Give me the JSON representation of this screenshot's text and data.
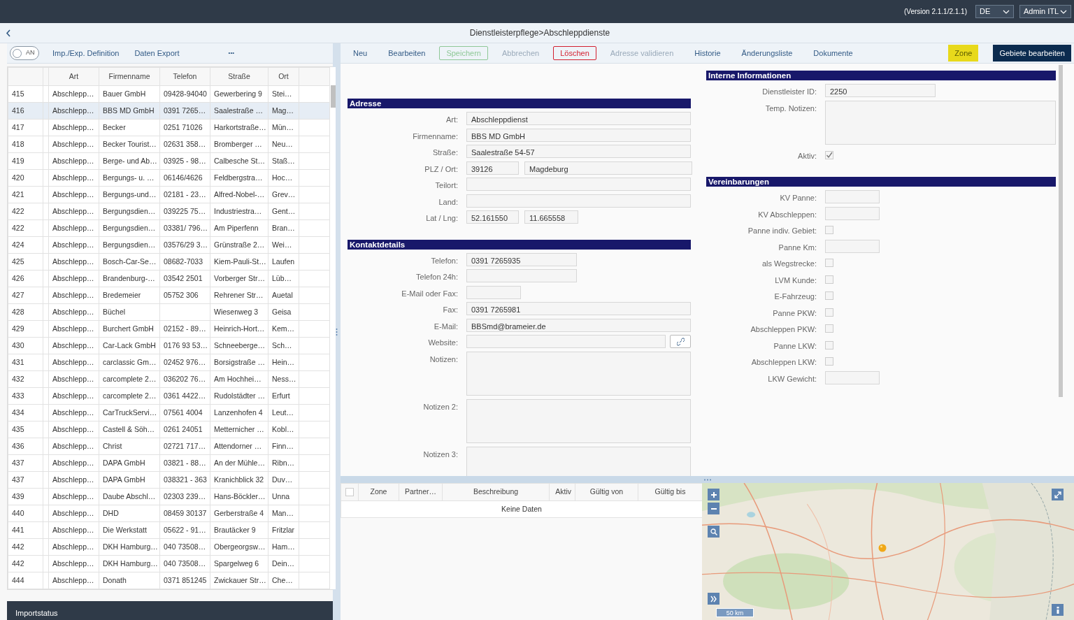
{
  "header": {
    "version": "(Version 2.1.1/2.1.1)",
    "language": "DE",
    "user": "Admin ITL"
  },
  "breadcrumb": "Dienstleisterpflege>Abschleppdienste",
  "left_toolbar": {
    "toggle": {
      "label": "AN",
      "on": false
    },
    "items": [
      "Imp./Exp. Definition",
      "Daten Export"
    ],
    "more": "•••"
  },
  "table": {
    "columns": [
      "Art",
      "Firmenname",
      "Telefon",
      "Straße",
      "Ort"
    ],
    "rows": [
      {
        "number": "415",
        "cells": [
          "Abschlepp…",
          "Bauer GmbH",
          "09428-94040",
          "Gewerbering 9",
          "Stei…"
        ],
        "selected": false
      },
      {
        "number": "416",
        "cells": [
          "Abschlepp…",
          "BBS MD GmbH",
          "0391 7265…",
          "Saalestraße …",
          "Mag…"
        ],
        "selected": true
      },
      {
        "number": "417",
        "cells": [
          "Abschlepp…",
          "Becker",
          "0251 71026",
          "Harkortstraße…",
          "Mün…"
        ],
        "selected": false
      },
      {
        "number": "418",
        "cells": [
          "Abschlepp…",
          "Becker Tourist…",
          "02631 358…",
          "Bromberger …",
          "Neu…"
        ],
        "selected": false
      },
      {
        "number": "419",
        "cells": [
          "Abschlepp…",
          "Berge- und Ab…",
          "03925 - 98…",
          "Calbesche St…",
          "Staß…"
        ],
        "selected": false
      },
      {
        "number": "420",
        "cells": [
          "Abschlepp…",
          "Bergungs- u. …",
          "06146/4626",
          "Feldbergstra…",
          "Hoc…"
        ],
        "selected": false
      },
      {
        "number": "421",
        "cells": [
          "Abschlepp…",
          "Bergungs-und…",
          "02181 - 23…",
          "Alfred-Nobel-…",
          "Grev…"
        ],
        "selected": false
      },
      {
        "number": "422",
        "cells": [
          "Abschlepp…",
          "Bergungsdien…",
          "039225 75…",
          "Industriestra…",
          "Gent…"
        ],
        "selected": false
      },
      {
        "number": "422",
        "cells": [
          "Abschlepp…",
          "Bergungsdien…",
          "03381/ 796…",
          "Am Piperfenn",
          "Bran…"
        ],
        "selected": false
      },
      {
        "number": "424",
        "cells": [
          "Abschlepp…",
          "Bergungsdien…",
          "03576/29 3…",
          "Grünstraße 2…",
          "Wei…"
        ],
        "selected": false
      },
      {
        "number": "425",
        "cells": [
          "Abschlepp…",
          "Bosch-Car-Se…",
          "08682-7033",
          "Kiem-Pauli-St…",
          "Laufen"
        ],
        "selected": false
      },
      {
        "number": "426",
        "cells": [
          "Abschlepp…",
          "Brandenburg-…",
          "03542 2501",
          "Vorberger Str…",
          "Lüb…"
        ],
        "selected": false
      },
      {
        "number": "427",
        "cells": [
          "Abschlepp…",
          "Bredemeier",
          "05752 306",
          "Rehrener Str…",
          "Auetal"
        ],
        "selected": false
      },
      {
        "number": "428",
        "cells": [
          "Abschlepp…",
          "Büchel",
          "",
          "Wiesenweg 3",
          "Geisa"
        ],
        "selected": false
      },
      {
        "number": "429",
        "cells": [
          "Abschlepp…",
          "Burchert GmbH",
          "02152 - 89…",
          "Heinrich-Hort…",
          "Kem…"
        ],
        "selected": false
      },
      {
        "number": "430",
        "cells": [
          "Abschlepp…",
          "Car-Lack GmbH",
          "0176 93 53…",
          "Schneeberge…",
          "Sch…"
        ],
        "selected": false
      },
      {
        "number": "431",
        "cells": [
          "Abschlepp…",
          "carclassic Gm…",
          "02452 976…",
          "Borsigstraße …",
          "Hein…"
        ],
        "selected": false
      },
      {
        "number": "432",
        "cells": [
          "Abschlepp…",
          "carcomplete 2…",
          "036202 76…",
          "Am Hochhei…",
          "Ness…"
        ],
        "selected": false
      },
      {
        "number": "433",
        "cells": [
          "Abschlepp…",
          "carcomplete 2…",
          "0361 4422…",
          "Rudolstädter …",
          "Erfurt"
        ],
        "selected": false
      },
      {
        "number": "434",
        "cells": [
          "Abschlepp…",
          "CarTruckServi…",
          "07561 4004",
          "Lanzenhofen 4",
          "Leut…"
        ],
        "selected": false
      },
      {
        "number": "435",
        "cells": [
          "Abschlepp…",
          "Castell & Söh…",
          "0261 24051",
          "Metternicher …",
          "Kobl…"
        ],
        "selected": false
      },
      {
        "number": "436",
        "cells": [
          "Abschlepp…",
          "Christ",
          "02721 717…",
          "Attendorner …",
          "Finn…"
        ],
        "selected": false
      },
      {
        "number": "437",
        "cells": [
          "Abschlepp…",
          "DAPA GmbH",
          "03821 - 88…",
          "An der Mühle…",
          "Ribn…"
        ],
        "selected": false
      },
      {
        "number": "437",
        "cells": [
          "Abschlepp…",
          "DAPA GmbH",
          "038321 - 363",
          "Kranichblick 32",
          "Duv…"
        ],
        "selected": false
      },
      {
        "number": "439",
        "cells": [
          "Abschlepp…",
          "Daube Abschl…",
          "02303 239…",
          "Hans-Böckler…",
          "Unna"
        ],
        "selected": false
      },
      {
        "number": "440",
        "cells": [
          "Abschlepp…",
          "DHD",
          "08459 30137",
          "Gerberstraße 4",
          "Man…"
        ],
        "selected": false
      },
      {
        "number": "441",
        "cells": [
          "Abschlepp…",
          "Die Werkstatt",
          "05622 - 91…",
          "Brautäcker 9",
          "Fritzlar"
        ],
        "selected": false
      },
      {
        "number": "442",
        "cells": [
          "Abschlepp…",
          "DKH Hamburg…",
          "040 73508…",
          "Obergeorgsw…",
          "Ham…"
        ],
        "selected": false
      },
      {
        "number": "442",
        "cells": [
          "Abschlepp…",
          "DKH Hamburg…",
          "040 73508…",
          "Spargelweg 6",
          "Dein…"
        ],
        "selected": false
      },
      {
        "number": "444",
        "cells": [
          "Abschlepp…",
          "Donath",
          "0371 851245",
          "Zwickauer Str…",
          "Che…"
        ],
        "selected": false
      }
    ]
  },
  "status_panel": {
    "title": "Importstatus"
  },
  "toolbar": {
    "buttons": [
      {
        "label": "Neu",
        "kind": "text",
        "disabled": false
      },
      {
        "label": "Bearbeiten",
        "kind": "text",
        "disabled": false
      },
      {
        "label": "Speichern",
        "kind": "success",
        "disabled": true
      },
      {
        "label": "Abbrechen",
        "kind": "text",
        "disabled": true
      },
      {
        "label": "Löschen",
        "kind": "danger",
        "disabled": false
      },
      {
        "label": "Adresse validieren",
        "kind": "text",
        "disabled": true
      },
      {
        "label": "Historie",
        "kind": "text",
        "disabled": false
      },
      {
        "label": "Änderungsliste",
        "kind": "text",
        "disabled": false
      },
      {
        "label": "Dokumente",
        "kind": "text",
        "disabled": false
      }
    ],
    "actions": [
      {
        "label": "Zone",
        "kind": "warning"
      },
      {
        "label": "Gebiete bearbeiten",
        "kind": "primary"
      }
    ]
  },
  "form": {
    "left": [
      {
        "title": "Adresse",
        "fields": [
          {
            "label": "Art:",
            "kind": "long",
            "value": "Abschleppdienst"
          },
          {
            "label": "Firmenname:",
            "kind": "long",
            "value": "BBS MD GmbH"
          },
          {
            "label": "Straße:",
            "kind": "long",
            "value": "Saalestraße 54-57"
          },
          {
            "label": "PLZ / Ort:",
            "kind": "pair",
            "values": [
              "39126",
              "Magdeburg"
            ]
          },
          {
            "label": "Teilort:",
            "kind": "long"
          },
          {
            "label": "Land:",
            "kind": "long"
          },
          {
            "label": "Lat / Lng:",
            "kind": "coords",
            "values": [
              "52.161550",
              "11.665558"
            ]
          }
        ]
      },
      {
        "title": "Kontaktdetails",
        "fields": [
          {
            "label": "Telefon:",
            "kind": "medium",
            "value": "0391 7265935"
          },
          {
            "label": "Telefon 24h:",
            "kind": "medium"
          },
          {
            "label": "E-Mail oder Fax:",
            "kind": "short"
          },
          {
            "label": "Fax:",
            "kind": "long",
            "value": "0391 7265981"
          },
          {
            "label": "E-Mail:",
            "kind": "long",
            "value": "BBSmd@brameier.de"
          },
          {
            "label": "Website:",
            "kind": "link"
          },
          {
            "label": "Notizen:",
            "kind": "textarea"
          },
          {
            "label": "Notizen 2:",
            "kind": "textarea"
          },
          {
            "label": "Notizen 3:",
            "kind": "textarea"
          }
        ]
      }
    ],
    "right": [
      {
        "title": "Interne Informationen",
        "fields": [
          {
            "label": "Dienstleister ID:",
            "kind": "medium",
            "value": "2250"
          },
          {
            "label": "Temp. Notizen:",
            "kind": "textarea"
          },
          {
            "label": "Aktiv:",
            "kind": "checkbox",
            "checked": true
          }
        ]
      },
      {
        "title": "Vereinbarungen",
        "fields": [
          {
            "label": "KV Panne:",
            "kind": "short"
          },
          {
            "label": "KV Abschleppen:",
            "kind": "short"
          },
          {
            "label": "Panne indiv. Gebiet:",
            "kind": "checkbox",
            "checked": false
          },
          {
            "label": "Panne Km:",
            "kind": "short"
          },
          {
            "label": "als Wegstrecke:",
            "kind": "checkbox",
            "checked": false
          },
          {
            "label": "LVM Kunde:",
            "kind": "checkbox",
            "checked": false
          },
          {
            "label": "E-Fahrzeug:",
            "kind": "checkbox",
            "checked": false
          },
          {
            "label": "Panne PKW:",
            "kind": "checkbox",
            "checked": false
          },
          {
            "label": "Abschleppen PKW:",
            "kind": "checkbox",
            "checked": false
          },
          {
            "label": "Panne LKW:",
            "kind": "checkbox",
            "checked": false
          },
          {
            "label": "Abschleppen LKW:",
            "kind": "checkbox",
            "checked": false
          },
          {
            "label": "LKW Gewicht:",
            "kind": "short"
          }
        ]
      }
    ]
  },
  "zones": {
    "select_all": {
      "checked": false
    },
    "columns": [
      "Zone",
      "Partner…",
      "Beschreibung",
      "Aktiv",
      "Gültig von",
      "Gültig bis"
    ],
    "empty": "Keine Daten"
  },
  "map": {
    "scale": "50 km"
  }
}
